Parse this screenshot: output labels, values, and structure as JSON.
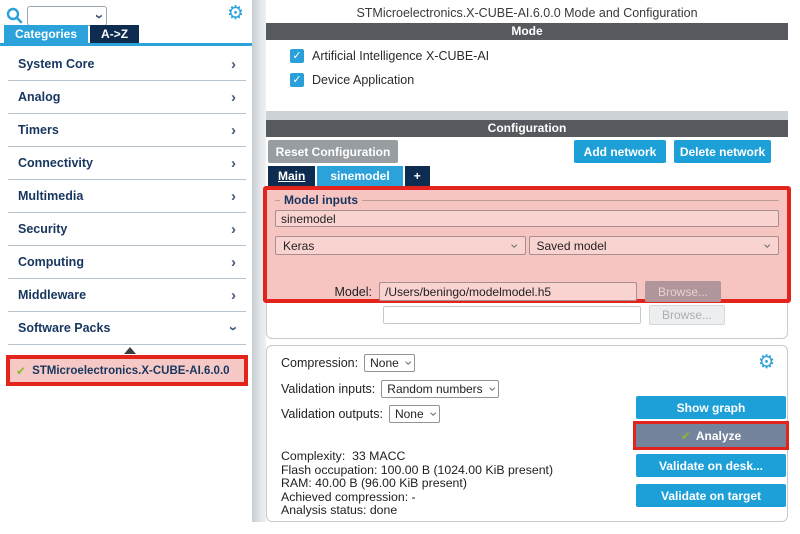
{
  "icons": {
    "gear": "⚙",
    "check": "✔",
    "tick": "✓"
  },
  "colors": {
    "accent_blue": "#2aa2d9",
    "navy": "#0e2c50",
    "highlight_red": "#e3241c",
    "highlight_pink": "#f6c5c2",
    "header_gray": "#565a5e",
    "button_gray": "#989da2",
    "analyze_slate": "#74849d",
    "check_green": "#8ab933"
  },
  "left_panel": {
    "search": {
      "value": "",
      "placeholder": ""
    },
    "tabs": [
      {
        "label": "Categories"
      },
      {
        "label": "A->Z"
      }
    ],
    "categories": [
      {
        "label": "System Core"
      },
      {
        "label": "Analog"
      },
      {
        "label": "Timers"
      },
      {
        "label": "Connectivity"
      },
      {
        "label": "Multimedia"
      },
      {
        "label": "Security"
      },
      {
        "label": "Computing"
      },
      {
        "label": "Middleware"
      },
      {
        "label": "Software Packs"
      }
    ],
    "selected_pack": {
      "label": "STMicroelectronics.X-CUBE-AI.6.0.0"
    }
  },
  "main": {
    "title": "STMicroelectronics.X-CUBE-AI.6.0.0 Mode and Configuration",
    "mode": {
      "header": "Mode",
      "checkboxes": [
        {
          "label": "Artificial Intelligence X-CUBE-AI",
          "checked": true
        },
        {
          "label": "Device Application",
          "checked": true
        }
      ]
    },
    "configuration": {
      "header": "Configuration",
      "reset_button": "Reset Configuration",
      "add_button": "Add network",
      "delete_button": "Delete network",
      "tabs": [
        {
          "label": "Main"
        },
        {
          "label": "sinemodel"
        },
        {
          "label": "+"
        }
      ],
      "model_inputs": {
        "legend": "Model inputs",
        "network_name": "sinemodel",
        "framework": "Keras",
        "model_kind": "Saved model",
        "model_label": "Model:",
        "model_path": "/Users/beningo/modelmodel.h5",
        "browse_label": "Browse...",
        "secondary_value": "",
        "secondary_browse_label": "Browse..."
      },
      "analysis": {
        "compression_label": "Compression:",
        "compression_value": "None",
        "validation_inputs_label": "Validation inputs:",
        "validation_inputs_value": "Random numbers",
        "validation_outputs_label": "Validation outputs:",
        "validation_outputs_value": "None",
        "show_graph_button": "Show graph",
        "analyze_button": "Analyze",
        "validate_desk_button": "Validate on desk...",
        "validate_target_button": "Validate on target",
        "stats": [
          "Complexity:  33 MACC",
          "Flash occupation: 100.00 B (1024.00 KiB present)",
          "RAM: 40.00 B (96.00 KiB present)",
          "Achieved compression: -",
          "Analysis status: done"
        ]
      }
    }
  }
}
